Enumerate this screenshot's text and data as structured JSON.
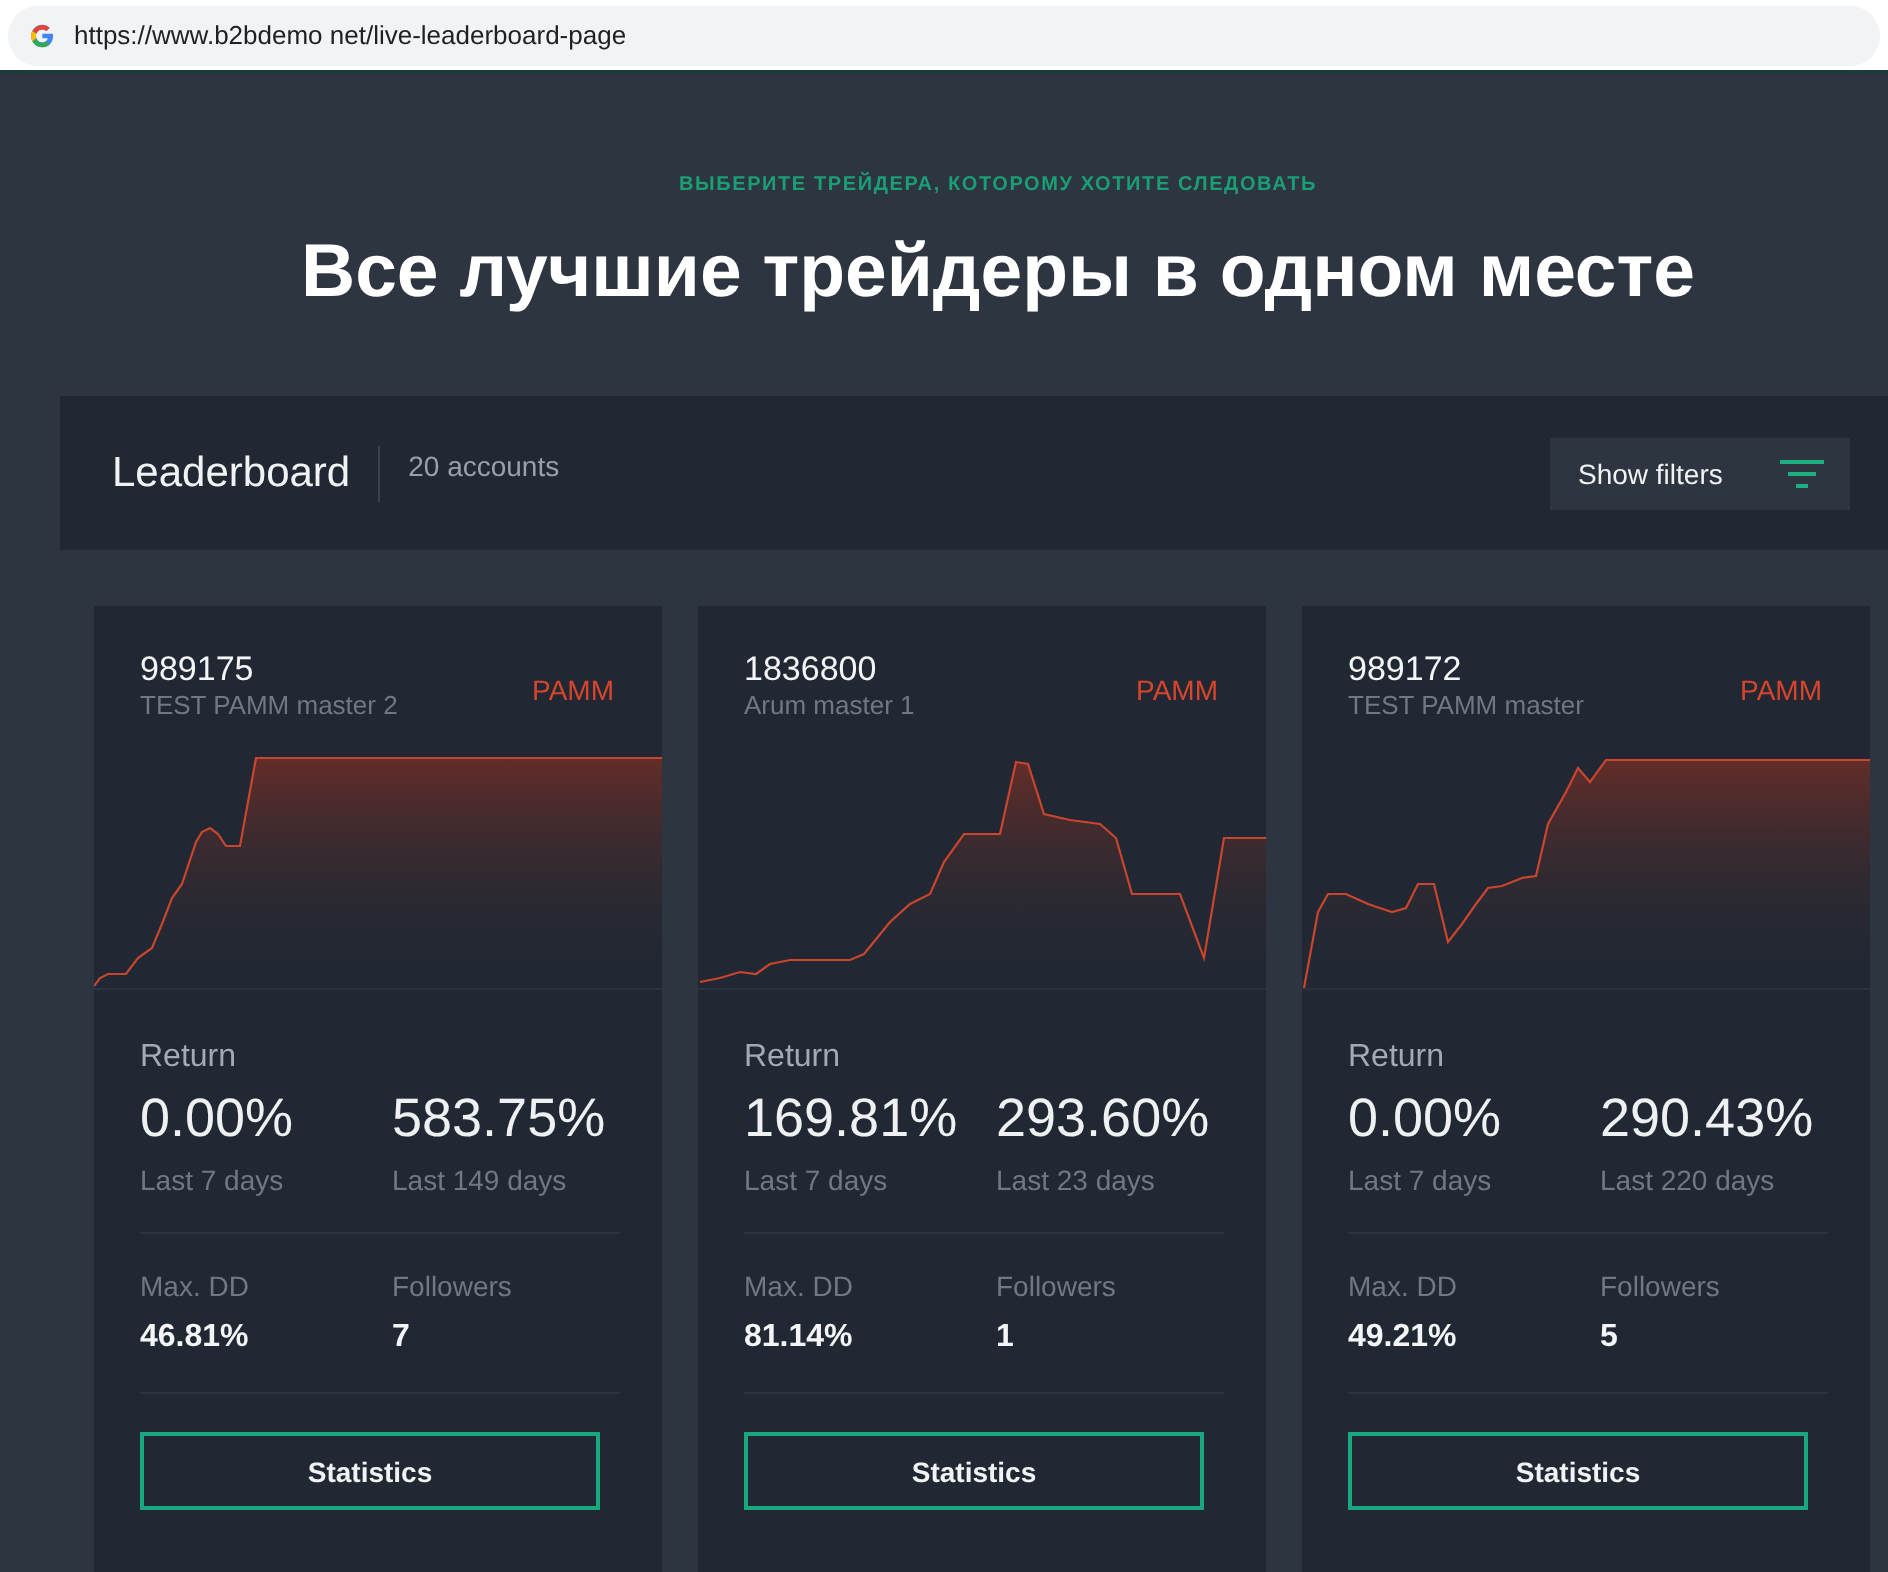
{
  "browser": {
    "url": "https://www.b2bdemo net/live-leaderboard-page"
  },
  "hero": {
    "eyebrow": "ВЫБЕРИТЕ ТРЕЙДЕРА, КОТОРОМУ ХОТИТЕ СЛЕДОВАТЬ",
    "title": "Все лучшие трейдеры в одном месте"
  },
  "leaderboard": {
    "title": "Leaderboard",
    "count": "20 accounts",
    "filter_button": "Show filters"
  },
  "cards": [
    {
      "account": "989175",
      "name": "TEST PAMM master 2",
      "type": "PAMM",
      "return_label": "Return",
      "return_week": "0.00%",
      "week_label": "Last 7 days",
      "return_total": "583.75%",
      "total_label": "Last 149 days",
      "max_dd_label": "Max. DD",
      "max_dd": "46.81%",
      "followers_label": "Followers",
      "followers": "7",
      "button": "Statistics"
    },
    {
      "account": "1836800",
      "name": "Arum master 1",
      "type": "PAMM",
      "return_label": "Return",
      "return_week": "169.81%",
      "week_label": "Last 7 days",
      "return_total": "293.60%",
      "total_label": "Last 23 days",
      "max_dd_label": "Max. DD",
      "max_dd": "81.14%",
      "followers_label": "Followers",
      "followers": "1",
      "button": "Statistics"
    },
    {
      "account": "989172",
      "name": "TEST PAMM master",
      "type": "PAMM",
      "return_label": "Return",
      "return_week": "0.00%",
      "week_label": "Last 7 days",
      "return_total": "290.43%",
      "total_label": "Last 220 days",
      "max_dd_label": "Max. DD",
      "max_dd": "49.21%",
      "followers_label": "Followers",
      "followers": "5",
      "button": "Statistics"
    }
  ]
}
